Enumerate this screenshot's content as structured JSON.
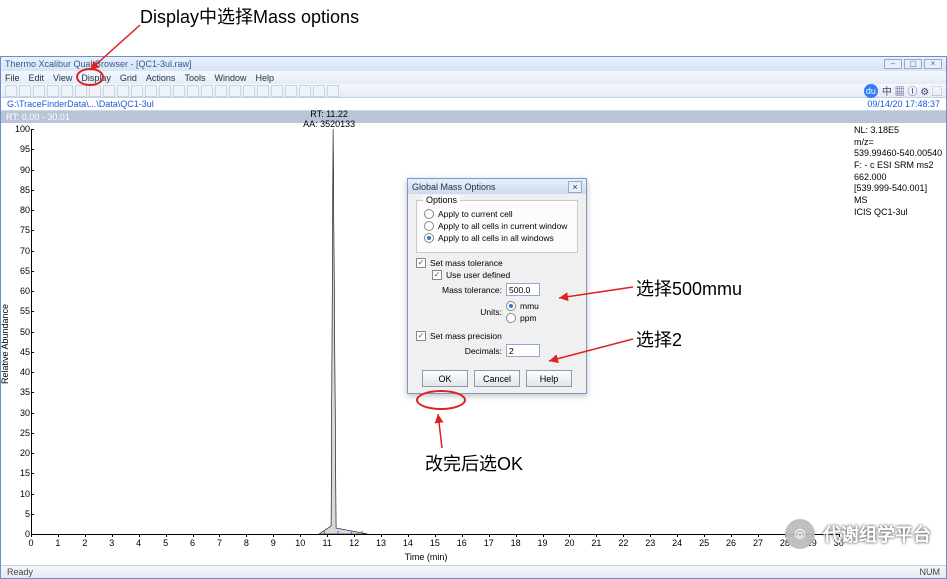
{
  "annotations": {
    "top": "Display中选择Mass options",
    "mmu": "选择500mmu",
    "decimals_note": "选择2",
    "ok_note": "改完后选OK"
  },
  "titlebar": {
    "text": "Thermo Xcalibur Qual Browser - [QC1-3ul.raw]"
  },
  "menubar": {
    "items": [
      "File",
      "Edit",
      "View",
      "Display",
      "Grid",
      "Actions",
      "Tools",
      "Window",
      "Help"
    ]
  },
  "pathbar": {
    "path": "G:\\TraceFinderData\\...\\Data\\QC1-3ul",
    "timestamp": "09/14/20 17:48:37"
  },
  "rt_header": "RT: 0.00 - 30.01",
  "info_panel": [
    "NL: 3.18E5",
    "m/z=",
    "539.99460-540.00540",
    "F: - c ESI SRM ms2",
    "662.000",
    "[539.999-540.001]  MS",
    "ICIS QC1-3ul"
  ],
  "chart_data": {
    "type": "line",
    "xlabel": "Time (min)",
    "ylabel": "Relative Abundance",
    "xlim": [
      0,
      30.01
    ],
    "ylim": [
      0,
      100
    ],
    "xticks": [
      0,
      1,
      2,
      3,
      4,
      5,
      6,
      7,
      8,
      9,
      10,
      11,
      12,
      13,
      14,
      15,
      16,
      17,
      18,
      19,
      20,
      21,
      22,
      23,
      24,
      25,
      26,
      27,
      28,
      29,
      30
    ],
    "yticks": [
      0,
      5,
      10,
      15,
      20,
      25,
      30,
      35,
      40,
      45,
      50,
      55,
      60,
      65,
      70,
      75,
      80,
      85,
      90,
      95,
      100
    ],
    "peak": {
      "rt_label": "RT: 11.22",
      "aa_label": "AA: 3520133",
      "apex_x": 11.22,
      "apex_y": 100,
      "base_left": 10.7,
      "base_right": 12.5
    }
  },
  "dialog": {
    "title": "Global Mass Options",
    "options_legend": "Options",
    "apply_current": "Apply to current cell",
    "apply_window": "Apply to all cells in current window",
    "apply_all": "Apply to all cells in all windows",
    "set_tol": "Set mass tolerance",
    "use_user": "Use user defined",
    "mass_tol_label": "Mass tolerance:",
    "mass_tol_value": "500.0",
    "units_label": "Units:",
    "unit_mmu": "mmu",
    "unit_ppm": "ppm",
    "set_prec": "Set mass precision",
    "decimals_label": "Decimals:",
    "decimals_value": "2",
    "ok": "OK",
    "cancel": "Cancel",
    "help": "Help"
  },
  "statusbar": {
    "left": "Ready",
    "right": "NUM"
  },
  "watermark": "代谢组学平台"
}
